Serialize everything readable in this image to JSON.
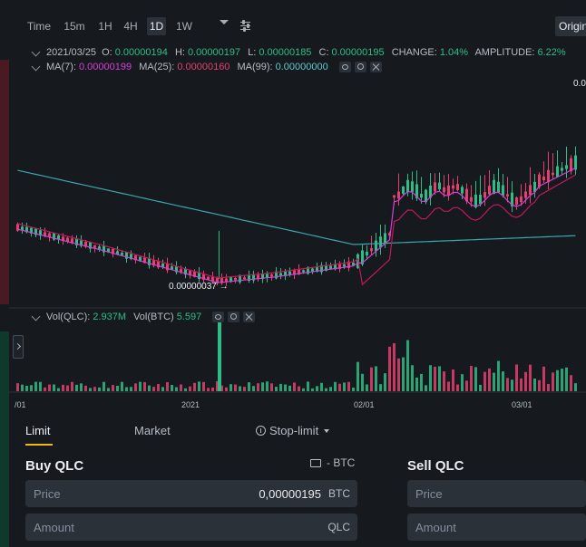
{
  "toolbar": {
    "intervals": [
      "Time",
      "15m",
      "1H",
      "4H",
      "1D",
      "1W"
    ],
    "active_interval": "1D",
    "view_button": "Original"
  },
  "chart": {
    "ohlc": {
      "date": "2021/03/25",
      "open_label": "O:",
      "open": "0.00000194",
      "high_label": "H:",
      "high": "0.00000197",
      "low_label": "L:",
      "low": "0.00000185",
      "close_label": "C:",
      "close": "0.00000195",
      "change_label": "CHANGE:",
      "change": "1.04%",
      "amplitude_label": "AMPLITUDE:",
      "amplitude": "6.22%"
    },
    "ma": {
      "ma7_label": "MA(7):",
      "ma7": "0.00000199",
      "ma25_label": "MA(25):",
      "ma25": "0.00000160",
      "ma99_label": "MA(99):",
      "ma99": "0.00000000"
    },
    "volume": {
      "qlc_label": "Vol(QLC):",
      "qlc": "2.937M",
      "btc_label": "Vol(BTC)",
      "btc": "5.597"
    },
    "price_top_label": "0.0",
    "min_price_label": "0.00000037",
    "x_ticks": [
      "/01",
      "2021",
      "02/01",
      "03/01"
    ],
    "colors": {
      "up": "#2ebd85",
      "down": "#e4406e",
      "ma7": "#d63fd6",
      "ma25": "#c2185b",
      "ma99": "#3aa8b0"
    }
  },
  "trade": {
    "tabs": [
      "Limit",
      "Market",
      "Stop-limit"
    ],
    "active_tab": "Limit",
    "buy": {
      "title": "Buy QLC",
      "balance": "- BTC",
      "price_label": "Price",
      "price_value": "0,00000195",
      "price_unit": "BTC",
      "amount_label": "Amount",
      "amount_unit": "QLC"
    },
    "sell": {
      "title": "Sell QLC",
      "price_label": "Price",
      "amount_label": "Amount"
    }
  }
}
